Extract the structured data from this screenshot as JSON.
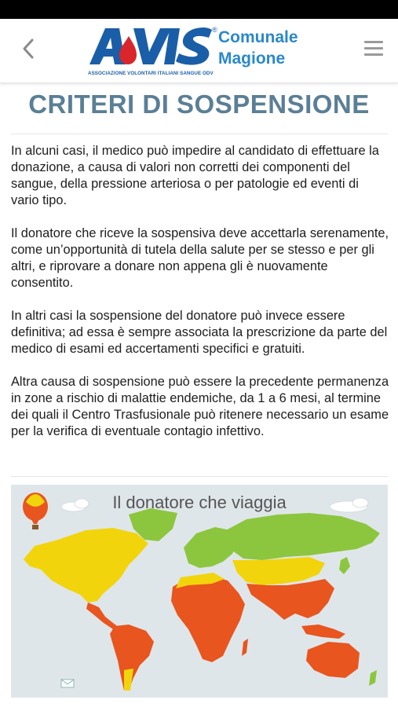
{
  "header": {
    "logo_text": "AVIS",
    "logo_registered": "®",
    "logo_line1": "Comunale",
    "logo_line2": "Magione",
    "logo_subtitle": "ASSOCIAZIONE VOLONTARI ITALIANI SANGUE ODV"
  },
  "page": {
    "title": "CRITERI DI SOSPENSIONE",
    "paragraphs": [
      "In alcuni casi, il medico può impedire al candidato di effettuare la donazione, a causa di valori non corretti dei componenti del sangue, della pressione arteriosa  o per patologie ed eventi di vario tipo.",
      "Il donatore che riceve la sospensiva deve accettarla serenamente, come un’opportunità di tutela della salute per se stesso e per gli altri, e riprovare a donare non appena gli è nuovamente consentito.",
      "In altri casi la sospensione del donatore può invece essere definitiva; ad essa è sempre associata la prescrizione da parte del medico di esami ed accertamenti specifici e gratuiti.",
      "Altra causa di sospensione può essere la precedente permanenza in zone a rischio di malattie endemiche, da 1 a 6 mesi, al termine dei quali il Centro Trasfusionale può ritenere necessario un esame per la verifica di eventuale contagio infettivo."
    ]
  },
  "map_image": {
    "title": "Il donatore che viaggia",
    "colors": {
      "safe": "#8cc63e",
      "medium": "#f2d40c",
      "high": "#e8551e",
      "ocean": "#dfe6ea"
    }
  },
  "colors": {
    "brand_blue": "#1a5ea8",
    "brand_light_blue": "#2a88cc",
    "title_color": "#5a7f96"
  }
}
